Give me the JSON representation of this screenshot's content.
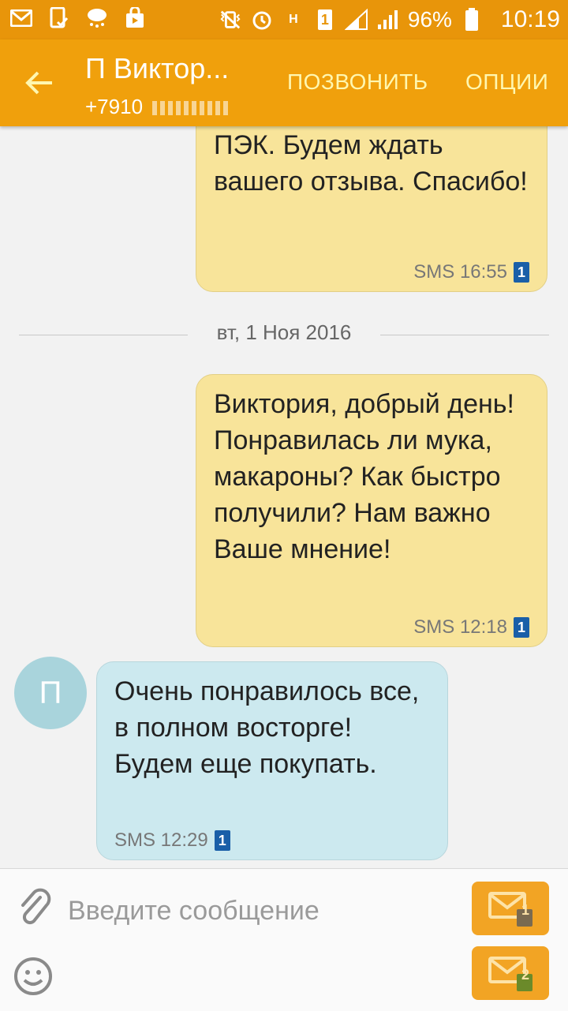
{
  "status_bar": {
    "battery_text": "96%",
    "time": "10:19",
    "sim_label": "1",
    "network_label": "H"
  },
  "header": {
    "title": "П Виктор...",
    "phone": "+7910",
    "call_label": "ПОЗВОНИТЬ",
    "options_label": "ОПЦИИ"
  },
  "messages": [
    {
      "direction": "outgoing",
      "text": "Ваш заказ передан в ТК ПЭК. Будем ждать вашего отзыва. Спасибо!",
      "meta": "SMS 16:55",
      "sim": "1"
    },
    {
      "direction": "outgoing",
      "text": "Виктория, добрый день! Понравилась ли мука, макароны? Как быстро получили? Нам важно Ваше мнение!",
      "meta": "SMS 12:18",
      "sim": "1"
    },
    {
      "direction": "incoming",
      "text": "Очень понравилось все, в полном восторге! Будем еще покупать.",
      "meta": "SMS 12:29",
      "sim": "1",
      "avatar_letter": "П"
    }
  ],
  "date_separator": "вт, 1 Ноя 2016",
  "composer": {
    "placeholder": "Введите сообщение",
    "send_sim1_label": "1",
    "send_sim2_label": "2"
  },
  "colors": {
    "status_bar": "#e8950a",
    "app_bar": "#f0a00c",
    "outgoing_bubble": "#f8e49a",
    "incoming_bubble": "#cce9ef",
    "send_button": "#f2a424",
    "sim_badge": "#1a5fa8"
  }
}
